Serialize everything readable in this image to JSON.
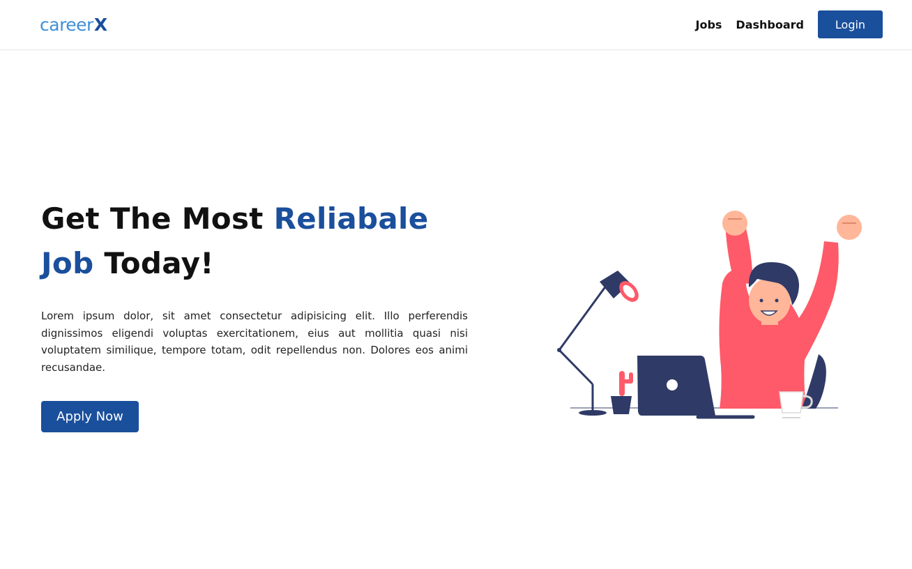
{
  "brand": {
    "logo_text": "career",
    "logo_mark": "X",
    "logo_color": "#3f8fd8",
    "logo_mark_color": "#1a4f9c"
  },
  "nav": {
    "links": [
      "Jobs",
      "Dashboard"
    ],
    "login_label": "Login"
  },
  "hero": {
    "title_part1": "Get The Most ",
    "title_highlight1": "Reliabale",
    "title_highlight2": "Job",
    "title_part2": " Today!",
    "description": "Lorem ipsum dolor, sit amet consectetur adipisicing elit. Illo perferendis dignissimos eligendi voluptas exercitationem, eius aut mollitia quasi nisi voluptatem similique, tempore totam, odit repellendus non. Dolores eos animi recusandae.",
    "cta_label": "Apply Now"
  },
  "colors": {
    "primary": "#1a4f9c",
    "text": "#111111",
    "illustration_accent": "#fe5a69",
    "illustration_dark": "#2f3a66"
  },
  "illustration": {
    "subject": "celebrating-person-at-desk"
  }
}
